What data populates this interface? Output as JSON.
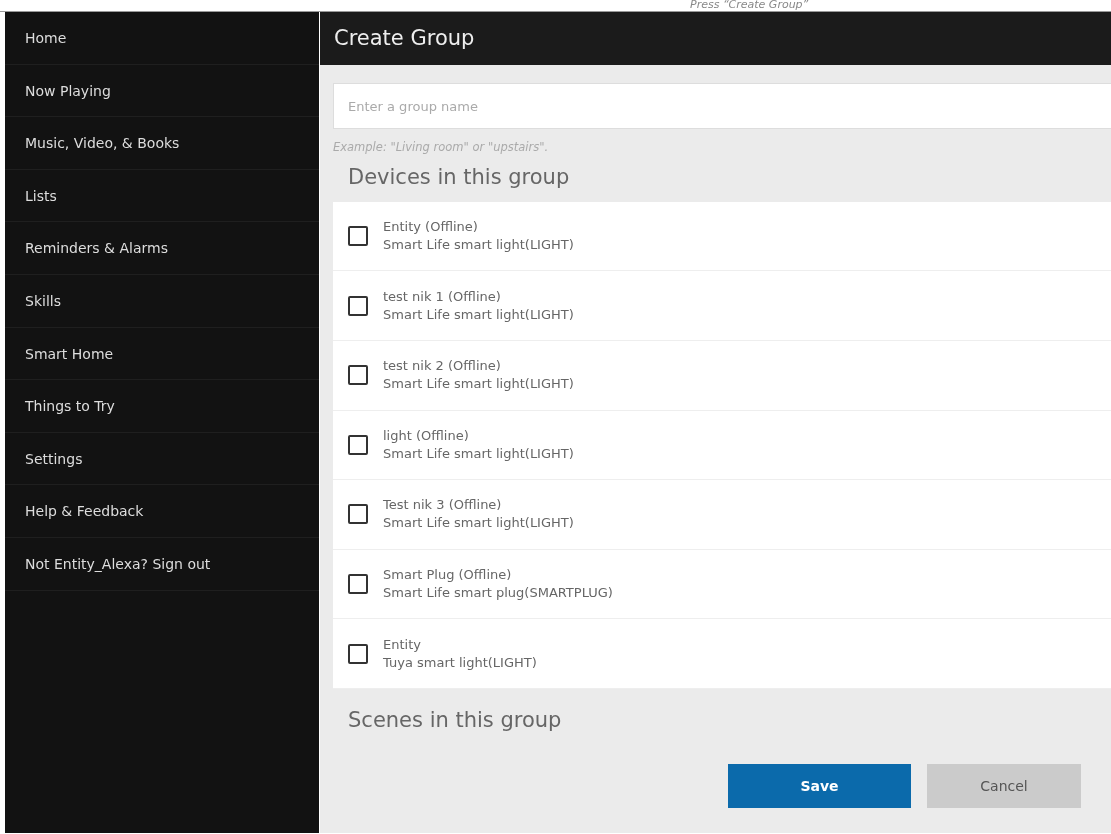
{
  "caption": "Press “Create Group”",
  "sidebar": {
    "items": [
      {
        "label": "Home"
      },
      {
        "label": "Now Playing"
      },
      {
        "label": "Music, Video, & Books"
      },
      {
        "label": "Lists"
      },
      {
        "label": "Reminders & Alarms"
      },
      {
        "label": "Skills"
      },
      {
        "label": "Smart Home"
      },
      {
        "label": "Things to Try"
      },
      {
        "label": "Settings"
      },
      {
        "label": "Help & Feedback"
      },
      {
        "label": "Not Entity_Alexa? Sign out"
      }
    ]
  },
  "header": {
    "title": "Create Group"
  },
  "group_name": {
    "placeholder": "Enter a group name",
    "hint": "Example: \"Living room\" or \"upstairs\"."
  },
  "devices": {
    "heading": "Devices in this group",
    "items": [
      {
        "name": "Entity (Offline)",
        "type": "Smart Life smart light(LIGHT)",
        "checked": false
      },
      {
        "name": "test nik 1 (Offline)",
        "type": "Smart Life smart light(LIGHT)",
        "checked": false
      },
      {
        "name": "test nik 2 (Offline)",
        "type": "Smart Life smart light(LIGHT)",
        "checked": false
      },
      {
        "name": "light (Offline)",
        "type": "Smart Life smart light(LIGHT)",
        "checked": false
      },
      {
        "name": "Test nik 3 (Offline)",
        "type": "Smart Life smart light(LIGHT)",
        "checked": false
      },
      {
        "name": "Smart Plug (Offline)",
        "type": "Smart Life smart plug(SMARTPLUG)",
        "checked": false
      },
      {
        "name": "Entity",
        "type": "Tuya smart light(LIGHT)",
        "checked": false
      }
    ]
  },
  "scenes": {
    "heading": "Scenes in this group"
  },
  "buttons": [
    {
      "label": "Save",
      "kind": "primary"
    },
    {
      "label": "Cancel",
      "kind": "secondary"
    }
  ]
}
